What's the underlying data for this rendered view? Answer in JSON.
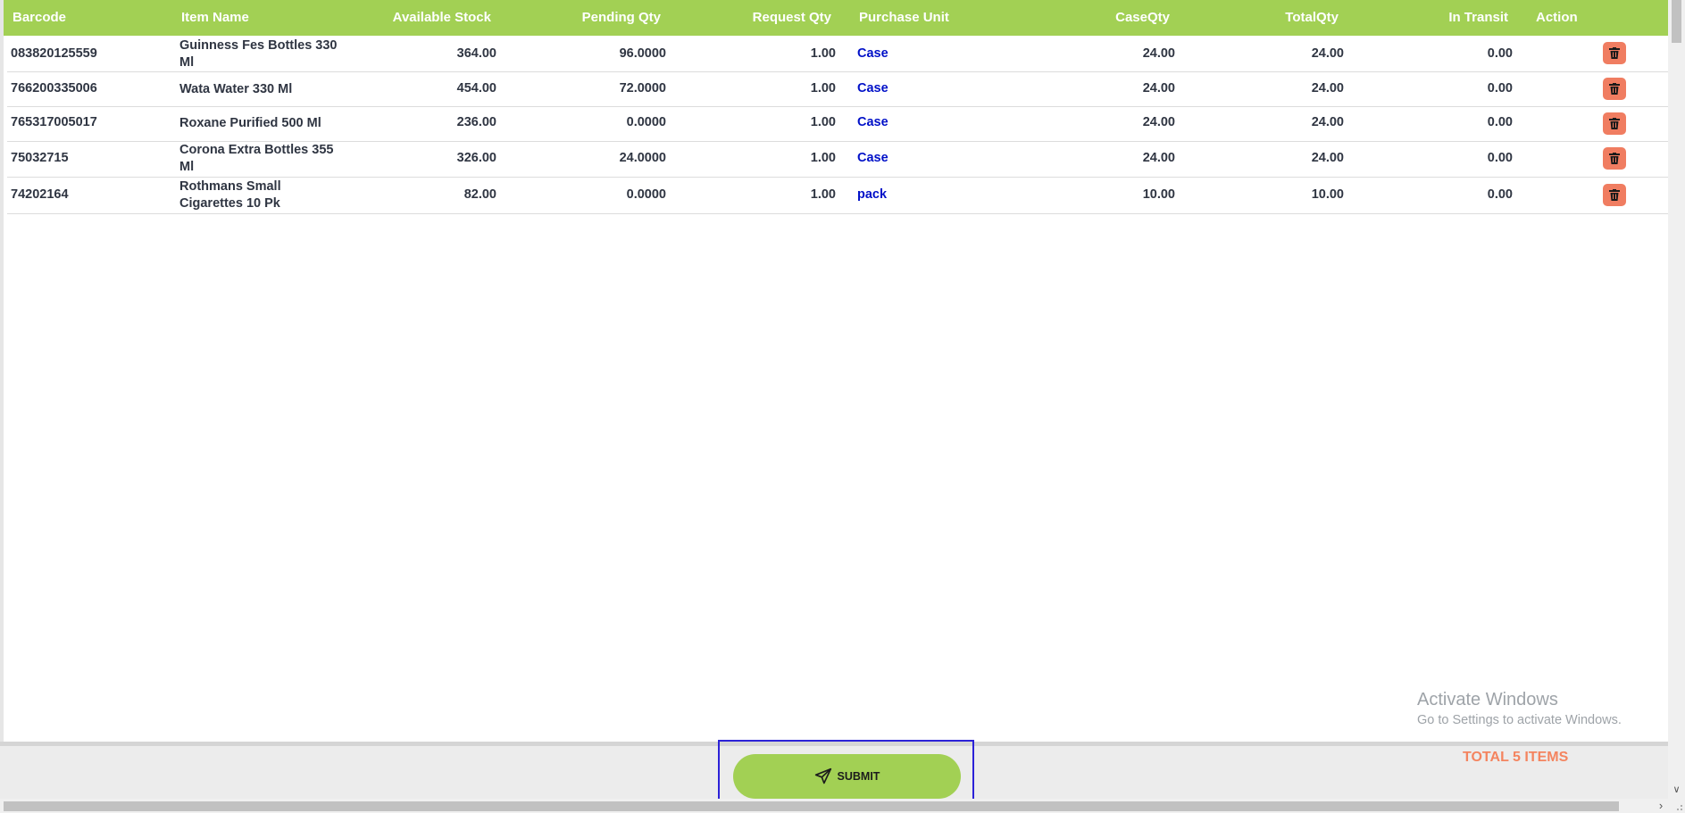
{
  "table": {
    "headers": {
      "barcode": "Barcode",
      "item_name": "Item Name",
      "available_stock": "Available Stock",
      "pending_qty": "Pending Qty",
      "request_qty": "Request Qty",
      "purchase_unit": "Purchase Unit",
      "case_qty": "CaseQty",
      "total_qty": "TotalQty",
      "in_transit": "In Transit",
      "action": "Action"
    },
    "rows": [
      {
        "barcode": "083820125559",
        "item_name": "Guinness Fes Bottles 330 Ml",
        "available_stock": "364.00",
        "pending_qty": "96.0000",
        "request_qty": "1.00",
        "purchase_unit": "Case",
        "case_qty": "24.00",
        "total_qty": "24.00",
        "in_transit": "0.00"
      },
      {
        "barcode": "766200335006",
        "item_name": "Wata Water 330 Ml",
        "available_stock": "454.00",
        "pending_qty": "72.0000",
        "request_qty": "1.00",
        "purchase_unit": "Case",
        "case_qty": "24.00",
        "total_qty": "24.00",
        "in_transit": "0.00"
      },
      {
        "barcode": "765317005017",
        "item_name": "Roxane Purified 500 Ml",
        "available_stock": "236.00",
        "pending_qty": "0.0000",
        "request_qty": "1.00",
        "purchase_unit": "Case",
        "case_qty": "24.00",
        "total_qty": "24.00",
        "in_transit": "0.00"
      },
      {
        "barcode": "75032715",
        "item_name": "Corona Extra Bottles 355 Ml",
        "available_stock": "326.00",
        "pending_qty": "24.0000",
        "request_qty": "1.00",
        "purchase_unit": "Case",
        "case_qty": "24.00",
        "total_qty": "24.00",
        "in_transit": "0.00"
      },
      {
        "barcode": "74202164",
        "item_name": "Rothmans Small Cigarettes 10 Pk",
        "available_stock": "82.00",
        "pending_qty": "0.0000",
        "request_qty": "1.00",
        "purchase_unit": "pack",
        "case_qty": "10.00",
        "total_qty": "10.00",
        "in_transit": "0.00"
      }
    ],
    "delete_icon": "trash-icon"
  },
  "footer": {
    "submit_label": "SUBMIT",
    "submit_icon": "paper-plane-icon",
    "total_label": "TOTAL 5 ITEMS"
  },
  "watermark": {
    "title": "Activate Windows",
    "subtitle": "Go to Settings to activate Windows."
  },
  "colors": {
    "header_bg": "#a2d054",
    "unit_link": "#0010c8",
    "delete_button": "#f07d61",
    "submit_bg": "#a2d054",
    "total_text": "#f4845f",
    "focus_frame": "#2c22d8"
  }
}
